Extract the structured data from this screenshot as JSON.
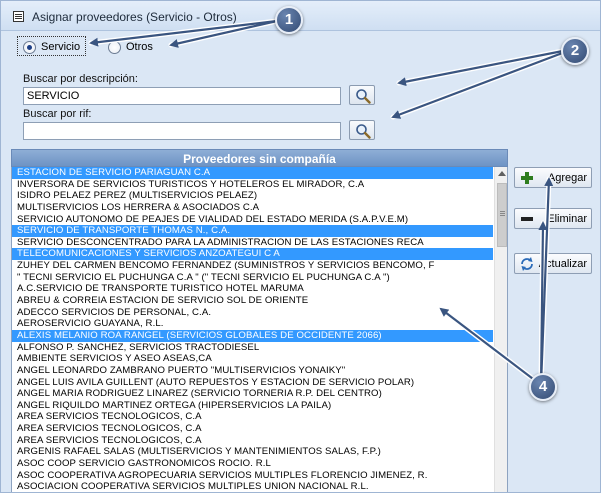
{
  "window": {
    "title": "Asignar proveedores (Servicio - Otros)"
  },
  "filter": {
    "options": [
      {
        "label": "Servicio",
        "selected": true
      },
      {
        "label": "Otros",
        "selected": false
      }
    ]
  },
  "search": {
    "description_label": "Buscar por descripción:",
    "description_value": "SERVICIO",
    "rif_label": "Buscar por rif:",
    "rif_value": ""
  },
  "list": {
    "header": "Proveedores sin compañía",
    "rows": [
      {
        "text": "ESTACION DE SERVICIO PARIAGUAN C.A",
        "selected": true
      },
      {
        "text": "INVERSORA DE SERVICIOS TURISTICOS Y HOTELEROS EL MIRADOR, C.A",
        "selected": false
      },
      {
        "text": "ISIDRO PELAEZ PEREZ (MULTISERVICIOS PELAEZ)",
        "selected": false
      },
      {
        "text": "MULTISERVICIOS LOS HERRERA & ASOCIADOS C.A",
        "selected": false
      },
      {
        "text": "SERVICIO AUTONOMO DE PEAJES DE VIALIDAD DEL ESTADO MERIDA (S.A.P.V.E.M)",
        "selected": false
      },
      {
        "text": "SERVICIO DE TRANSPORTE THOMAS N., C.A.",
        "selected": true
      },
      {
        "text": "SERVICIO DESCONCENTRADO PARA LA ADMINISTRACION DE LAS ESTACIONES RECA",
        "selected": false
      },
      {
        "text": "TELECOMUNICACIONES Y SERVICIOS ANZOATEGUI C A",
        "selected": true
      },
      {
        "text": "ZUHEY DEL CARMEN BENCOMO FERNANDEZ (SUMINISTROS Y SERVICIOS BENCOMO, F",
        "selected": false
      },
      {
        "text": "\" TECNI SERVICIO EL PUCHUNGA C.A \" (\" TECNI SERVICIO EL PUCHUNGA C.A \")",
        "selected": false
      },
      {
        "text": "A.C.SERVICIO DE TRANSPORTE TURISTICO HOTEL MARUMA",
        "selected": false
      },
      {
        "text": "ABREU & CORREIA ESTACION DE SERVICIO SOL DE ORIENTE",
        "selected": false
      },
      {
        "text": "ADECCO SERVICIOS DE PERSONAL, C.A.",
        "selected": false
      },
      {
        "text": "AEROSERVICIO GUAYANA, R.L.",
        "selected": false
      },
      {
        "text": "ALEXIS MELANIO ROA RANGEL (SERVICIOS GLOBALES DE OCCIDENTE 2066)",
        "selected": true
      },
      {
        "text": "ALFONSO P. SANCHEZ, SERVICIOS TRACTODIESEL",
        "selected": false
      },
      {
        "text": "AMBIENTE SERVICIOS Y ASEO ASEAS,CA",
        "selected": false
      },
      {
        "text": "ANGEL LEONARDO ZAMBRANO PUERTO \"MULTISERVICIOS YONAIKY\"",
        "selected": false
      },
      {
        "text": "ANGEL LUIS AVILA GUILLENT (AUTO REPUESTOS Y ESTACION DE SERVICIO POLAR)",
        "selected": false
      },
      {
        "text": "ANGEL MARIA RODRIGUEZ LINAREZ (SERVICIO TORNERIA R.P. DEL CENTRO)",
        "selected": false
      },
      {
        "text": "ANGEL RIQUILDO MARTINEZ ORTEGA (HIPERSERVICIOS LA PAILA)",
        "selected": false
      },
      {
        "text": "AREA SERVICIOS TECNOLOGICOS, C.A",
        "selected": false
      },
      {
        "text": "AREA SERVICIOS TECNOLOGICOS, C.A",
        "selected": false
      },
      {
        "text": "AREA SERVICIOS TECNOLOGICOS, C.A",
        "selected": false
      },
      {
        "text": "ARGENIS RAFAEL SALAS (MULTISERVICIOS Y MANTENIMIENTOS SALAS, F.P.)",
        "selected": false
      },
      {
        "text": "ASOC COOP SERVICIO GASTRONOMICOS ROCIO. R.L",
        "selected": false
      },
      {
        "text": "ASOC COOPERATIVA AGROPECUARIA SERVICIOS MULTIPLES FLORENCIO JIMENEZ, R.",
        "selected": false
      },
      {
        "text": "ASOCIACION COOPERATIVA SERVICIOS MULTIPLES UNION NACIONAL R.L.",
        "selected": false
      }
    ]
  },
  "actions": {
    "add_label": "Agregar",
    "remove_label": "Eliminar",
    "refresh_label": "Actualizar"
  },
  "annotations": {
    "badge1": "1",
    "badge2": "2",
    "badge4": "4"
  },
  "colors": {
    "selection": "#3399ff",
    "header": "#7a9dcc",
    "window_bg": "#dbe7f5",
    "badge": "#3a5580"
  }
}
